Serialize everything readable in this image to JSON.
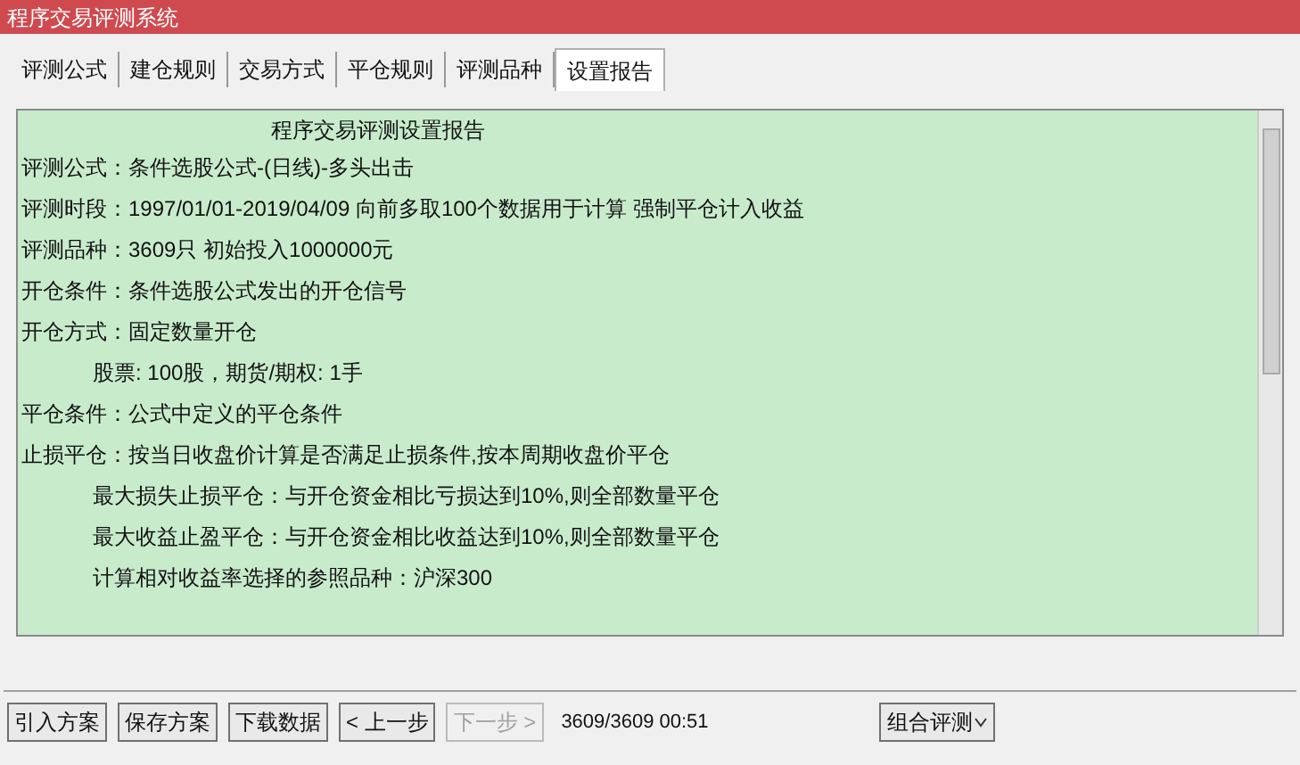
{
  "window": {
    "title": "程序交易评测系统"
  },
  "tabs": [
    {
      "label": "评测公式",
      "selected": false
    },
    {
      "label": "建仓规则",
      "selected": false
    },
    {
      "label": "交易方式",
      "selected": false
    },
    {
      "label": "平仓规则",
      "selected": false
    },
    {
      "label": "评测品种",
      "selected": false
    },
    {
      "label": "设置报告",
      "selected": true
    }
  ],
  "report": {
    "heading": "程序交易评测设置报告",
    "lines": [
      {
        "text": "评测公式：条件选股公式-(日线)-多头出击"
      },
      {
        "text": "评测时段：1997/01/01-2019/04/09 向前多取100个数据用于计算 强制平仓计入收益"
      },
      {
        "text": "评测品种：3609只 初始投入1000000元"
      },
      {
        "text": "开仓条件：条件选股公式发出的开仓信号"
      },
      {
        "text": "开仓方式：固定数量开仓",
        "children": [
          {
            "text": "股票: 100股，期货/期权: 1手"
          }
        ]
      },
      {
        "text": "平仓条件：公式中定义的平仓条件"
      },
      {
        "text": "止损平仓：按当日收盘价计算是否满足止损条件,按本周期收盘价平仓",
        "children": [
          {
            "text": "最大损失止损平仓：与开仓资金相比亏损达到10%,则全部数量平仓"
          },
          {
            "text": "最大收益止盈平仓：与开仓资金相比收益达到10%,则全部数量平仓"
          },
          {
            "text": "计算相对收益率选择的参照品种：沪深300"
          }
        ]
      }
    ]
  },
  "toolbar": [
    {
      "label": "引入方案",
      "disabled": false
    },
    {
      "label": "保存方案",
      "disabled": false
    },
    {
      "label": "下载数据",
      "disabled": false
    },
    {
      "label": "< 上一步",
      "disabled": false
    },
    {
      "label": "下一步 >",
      "disabled": true
    }
  ],
  "progress": "3609/3609 00:51",
  "mode_dropdown": {
    "value": "组合评测"
  }
}
